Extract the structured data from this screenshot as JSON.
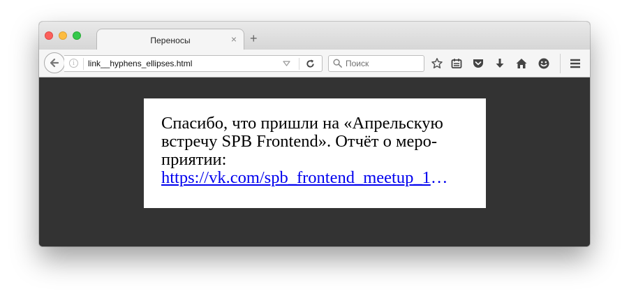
{
  "window": {
    "tab_title": "Переносы",
    "tab_close": "×",
    "new_tab": "+"
  },
  "toolbar": {
    "url": "link__hyphens_ellipses.html",
    "search_placeholder": "Поиск",
    "icons": [
      "back-arrow-icon",
      "info-icon",
      "dropdown-icon",
      "reload-icon",
      "search-icon",
      "bookmark-star-icon",
      "reading-list-icon",
      "pocket-icon",
      "download-icon",
      "home-icon",
      "smiley-icon",
      "menu-icon"
    ]
  },
  "page": {
    "paragraph_line1": "Спасибо, что пришли на «Апрельскую",
    "paragraph_line2": "встречу SPB Frontend». Отчёт о меро-",
    "paragraph_line3": "приятии:",
    "link_text": "https://vk.com/spb_frontend_meetup_1",
    "ellipsis": "…"
  },
  "colors": {
    "page_background": "#333333",
    "card_background": "#ffffff",
    "link": "#0000ee"
  }
}
